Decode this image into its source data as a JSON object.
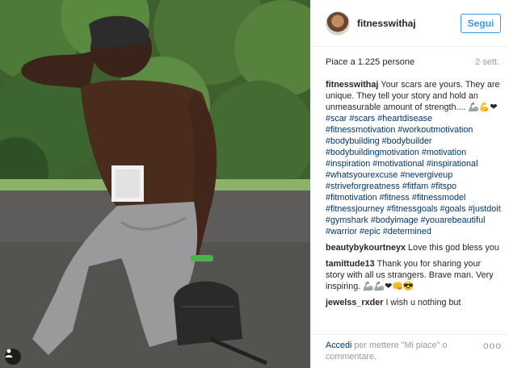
{
  "post": {
    "username": "fitnesswithaj",
    "follow_label": "Segui",
    "likes": "Piace a 1.225 persone",
    "time_ago": "2 sett.",
    "caption_user": "fitnesswithaj",
    "caption_text": "Your scars are yours. They are unique. They tell your story and hold an unmeasurable amount of strength.... ",
    "caption_emoji": "🦾💪❤",
    "hashtags": [
      "#scar",
      "#scars",
      "#heartdisease",
      "#fitnessmotivation",
      "#workoutmotivation",
      "#bodybuilding",
      "#bodybuilder",
      "#bodybuildingmotivation",
      "#motivation",
      "#inspiration",
      "#motivational",
      "#inspirational",
      "#whatsyourexcuse",
      "#nevergiveup",
      "#striveforgreatness",
      "#fitfam",
      "#fitspo",
      "#fitmotivation",
      "#fitness",
      "#fitnessmodel",
      "#fitnessjourney",
      "#fitnessgoals",
      "#goals",
      "#justdoit",
      "#gymshark",
      "#bodyimage",
      "#youarebeautiful",
      "#warrior",
      "#epic",
      "#determined"
    ]
  },
  "comments": [
    {
      "user": "beautybykourtneyx",
      "text": "Love this god bless you"
    },
    {
      "user": "tamittude13",
      "text": "Thank you for sharing your story with all us strangers. Brave man. Very inspiring. 🦾🦾❤👊😎"
    },
    {
      "user": "jewelss_rxder",
      "text": "I wish u nothing but"
    }
  ],
  "footer": {
    "login_label": "Accedi",
    "rest_label": " per mettere \"Mi piace\" o commentare.",
    "more_label": "ooo"
  },
  "icons": {
    "badge": "user-tag-icon"
  },
  "colors": {
    "accent": "#3897f0",
    "hashtag": "#003569",
    "muted": "#999999"
  }
}
